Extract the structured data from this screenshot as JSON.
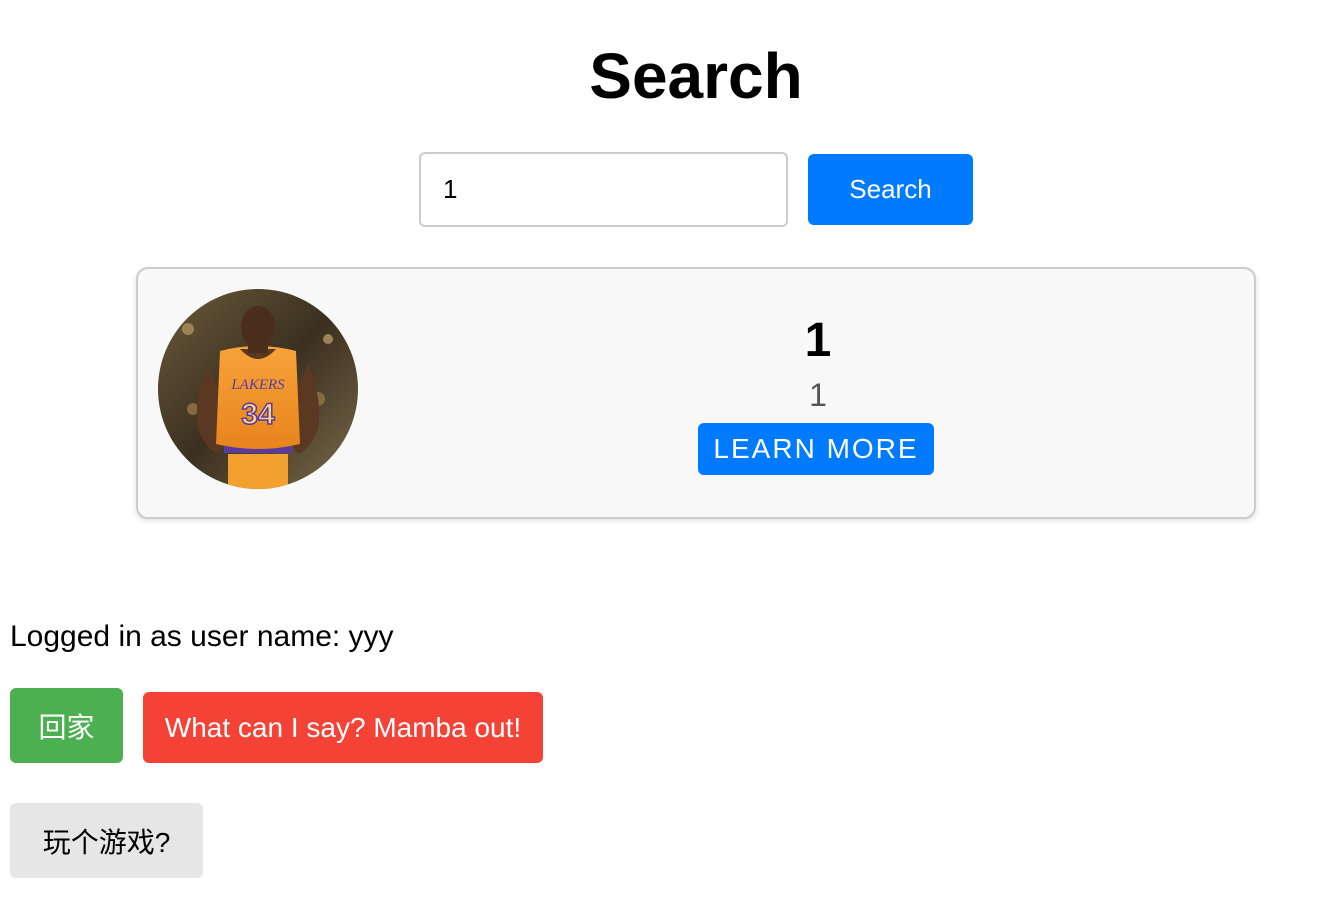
{
  "page_title": "Search",
  "search": {
    "value": "1",
    "button_label": "Search"
  },
  "result": {
    "title": "1",
    "subtitle": "1",
    "learn_more_label": "Learn More",
    "avatar_icon": "basketball-player-photo"
  },
  "user": {
    "status": "Logged in as user name: yyy"
  },
  "actions": {
    "home_label": "回家",
    "mamba_label": "What can I say? Mamba out!",
    "game_label": "玩个游戏?"
  },
  "colors": {
    "primary": "#007bff",
    "success": "#4caf50",
    "danger": "#f44336",
    "neutral": "#e6e6e6",
    "card_background": "#f8f8f8"
  }
}
